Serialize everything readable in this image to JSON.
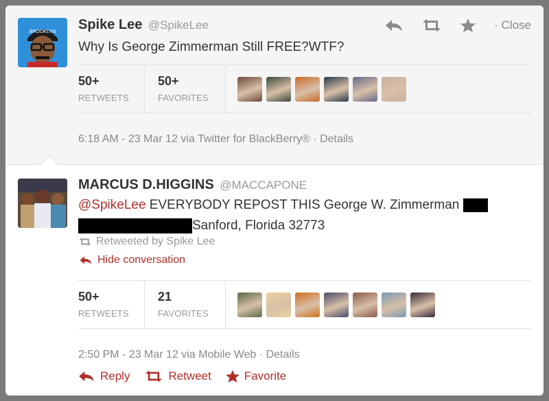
{
  "tweet1": {
    "name": "Spike Lee",
    "handle": "@SpikeLee",
    "text": "Why Is George Zimmerman Still FREE?WTF?",
    "retweets_count": "50+",
    "retweets_label": "RETWEETS",
    "favorites_count": "50+",
    "favorites_label": "FAVORITES",
    "meta_time": "6:18 AM - 23 Mar 12 via Twitter for BlackBerry®",
    "meta_sep": " · ",
    "meta_details": "Details",
    "avatar_text": "BROOKLYN",
    "close_label": "· Close"
  },
  "tweet2": {
    "name": "MARCUS D.HIGGINS",
    "handle": "@MACCAPONE",
    "mention": "@SpikeLee",
    "text_line1": " EVERYBODY REPOST THIS George W. Zimmerman ",
    "text_line2": "Sanford, Florida 32773",
    "retweeted_by": "Retweeted by Spike Lee",
    "hide_conversation": "Hide conversation",
    "retweets_count": "50+",
    "retweets_label": "RETWEETS",
    "favorites_count": "21",
    "favorites_label": "FAVORITES",
    "meta_time": "2:50 PM - 23 Mar 12 via Mobile Web",
    "meta_sep": " · ",
    "meta_details": "Details"
  },
  "bottom_actions": {
    "reply": "Reply",
    "retweet": "Retweet",
    "favorite": "Favorite"
  },
  "colors": {
    "accent": "#b0302a",
    "muted": "#999999",
    "text": "#333333"
  },
  "faces_tweet1": [
    "#6b4a3a",
    "#3b4a3a",
    "#c86a2a",
    "#2a3a4a",
    "#6a6a8a",
    "#c9b0a0"
  ],
  "faces_tweet2": [
    "#5a6a4a",
    "#e8d0a0",
    "#d07020",
    "#4a4a6a",
    "#8a5a4a",
    "#7a9ab0",
    "#3a2a3a"
  ]
}
